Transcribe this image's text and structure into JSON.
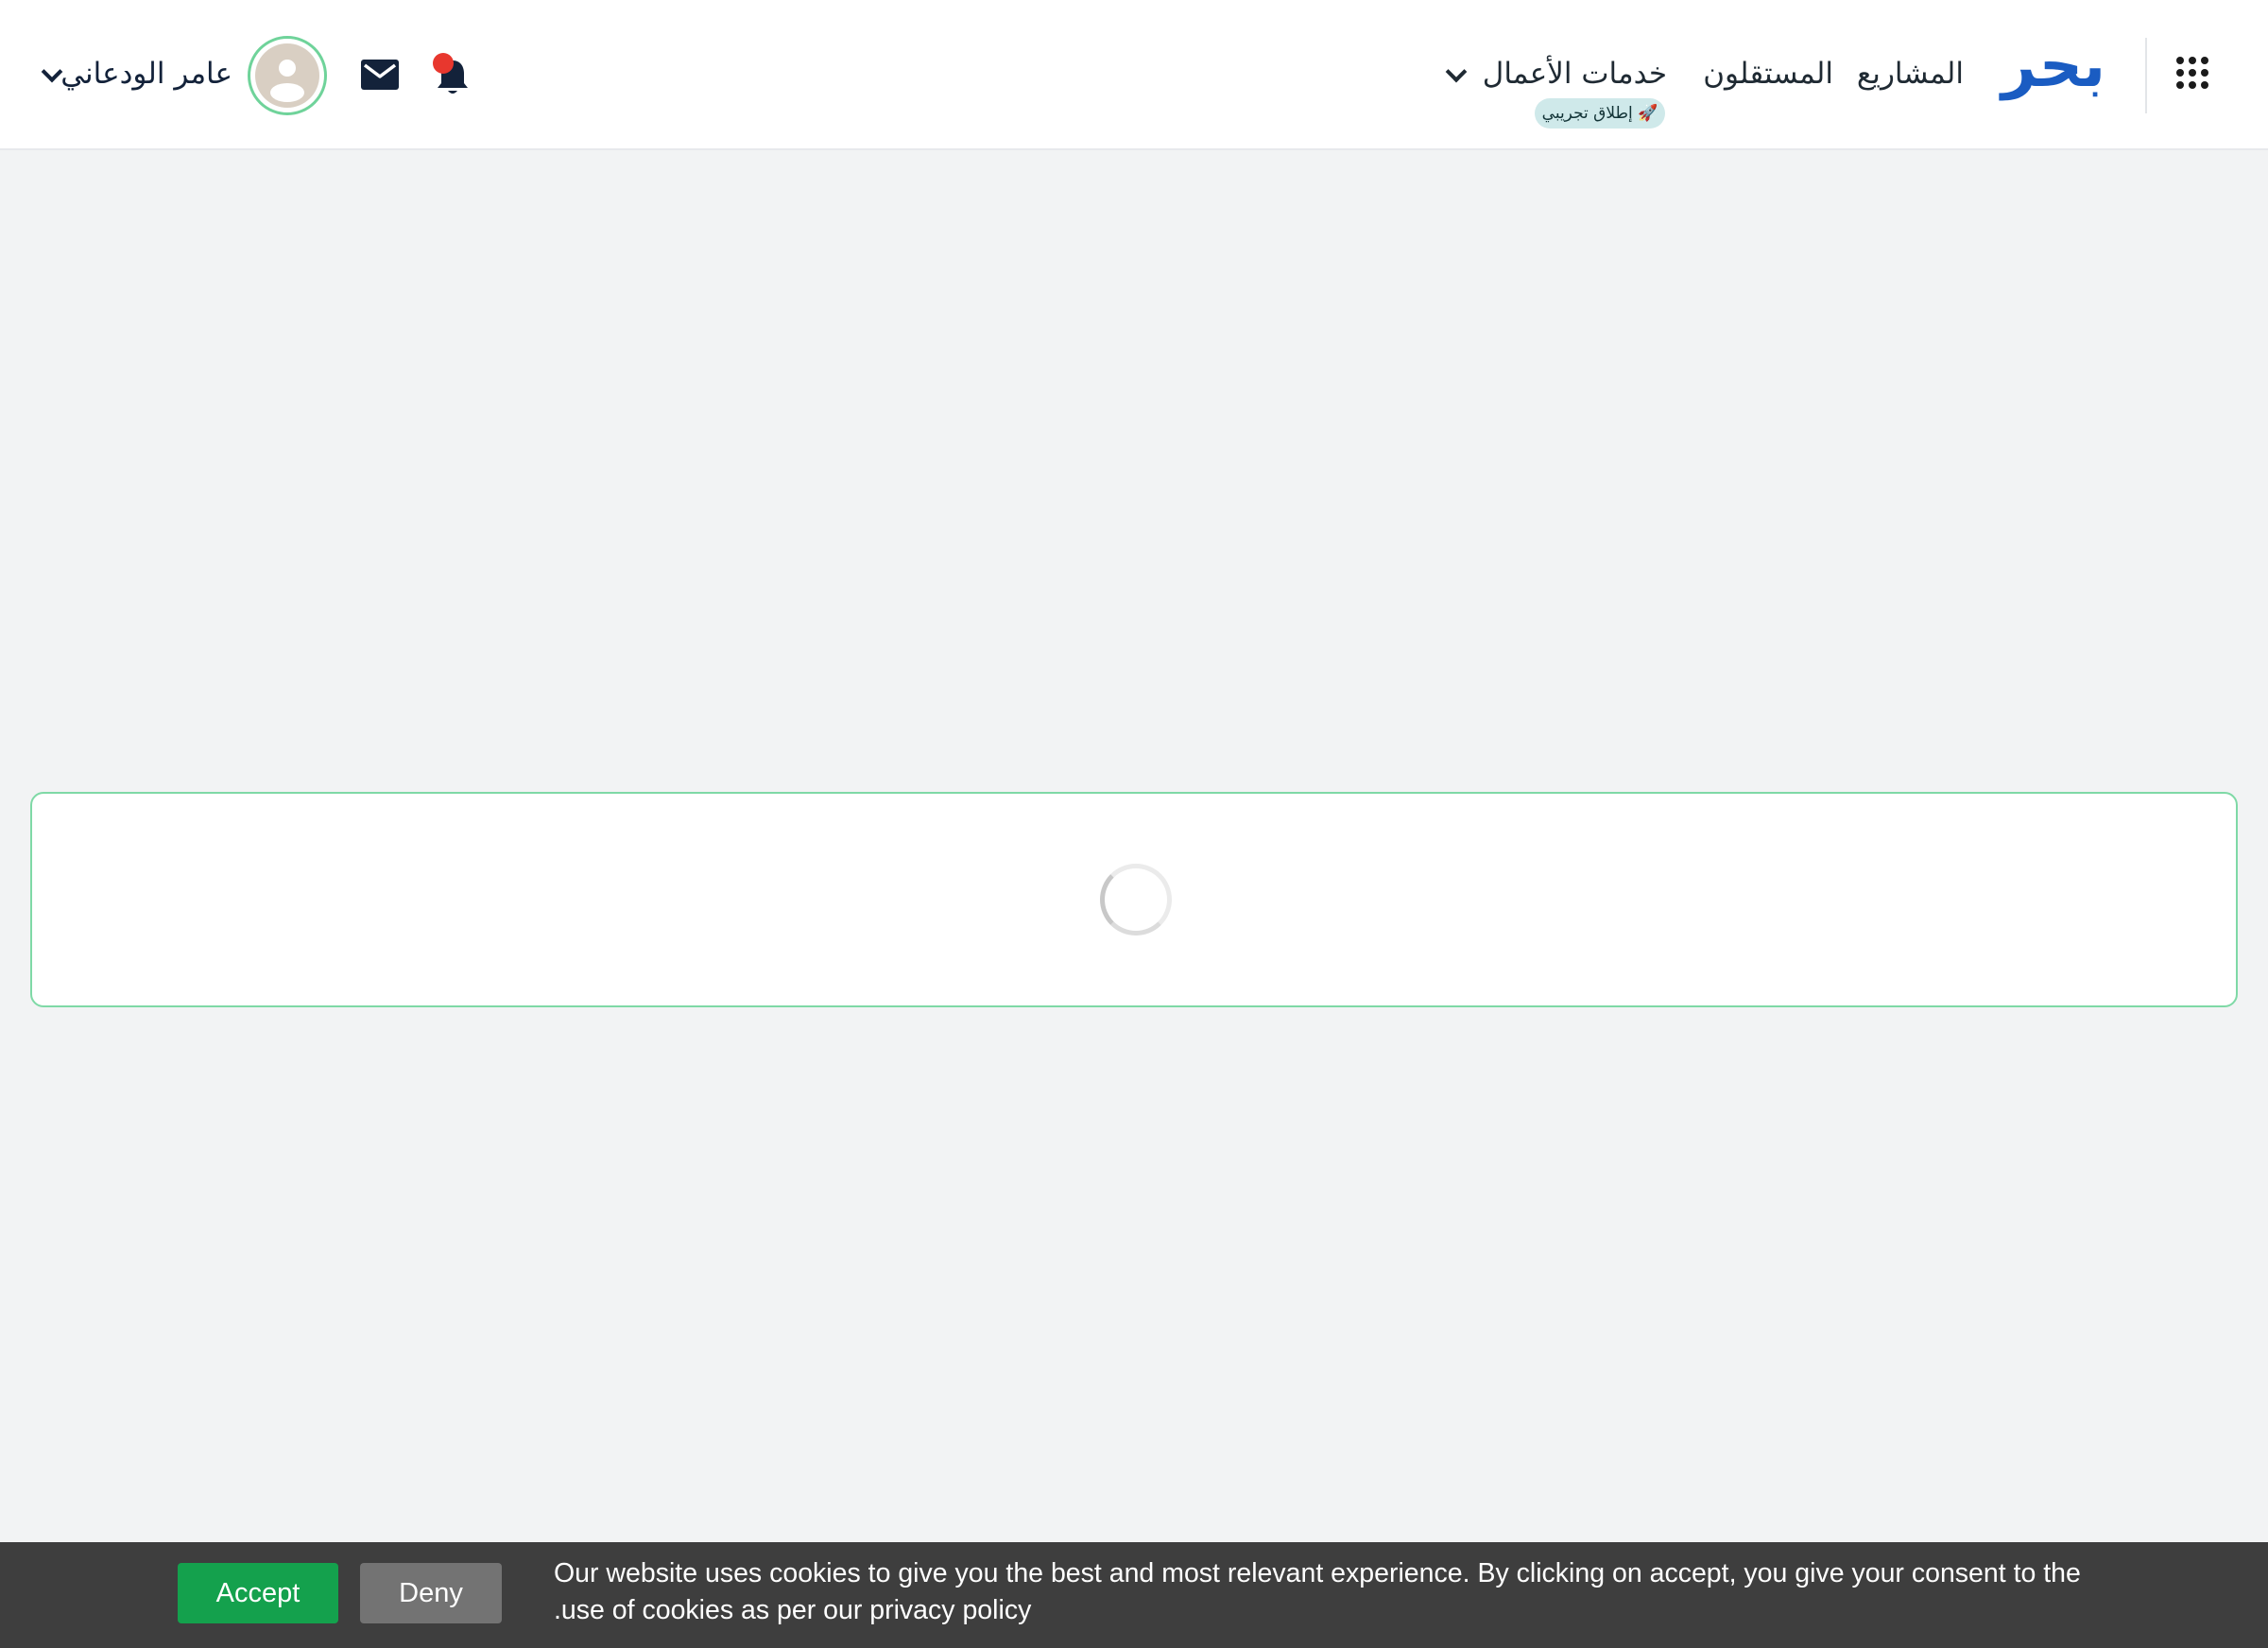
{
  "header": {
    "logo_text": "بحر",
    "nav": {
      "projects": "المشاريع",
      "freelancers": "المستقلون",
      "business_services": "خدمات الأعمال",
      "beta_badge": "🚀 إطلاق تجريبي"
    },
    "user": {
      "name": "عامر الودعاني"
    },
    "icons": {
      "apps": "apps-grid-icon",
      "notifications": "bell-icon",
      "messages": "mail-icon",
      "avatar": "user-avatar-icon"
    }
  },
  "main": {
    "loading_indicator": "spinner-icon"
  },
  "cookie_banner": {
    "message_line1": "Our website uses cookies to give you the best and most relevant experience. By clicking on accept, you give your consent to the",
    "message_line2": ".use of cookies as per our privacy policy",
    "accept_label": "Accept",
    "deny_label": "Deny"
  },
  "colors": {
    "brand_blue": "#1a5cc2",
    "accent_green": "#14a14d",
    "card_border": "#7fd9a6",
    "notification_dot": "#e8372e",
    "cookie_bar_bg": "#3e3e3e"
  }
}
